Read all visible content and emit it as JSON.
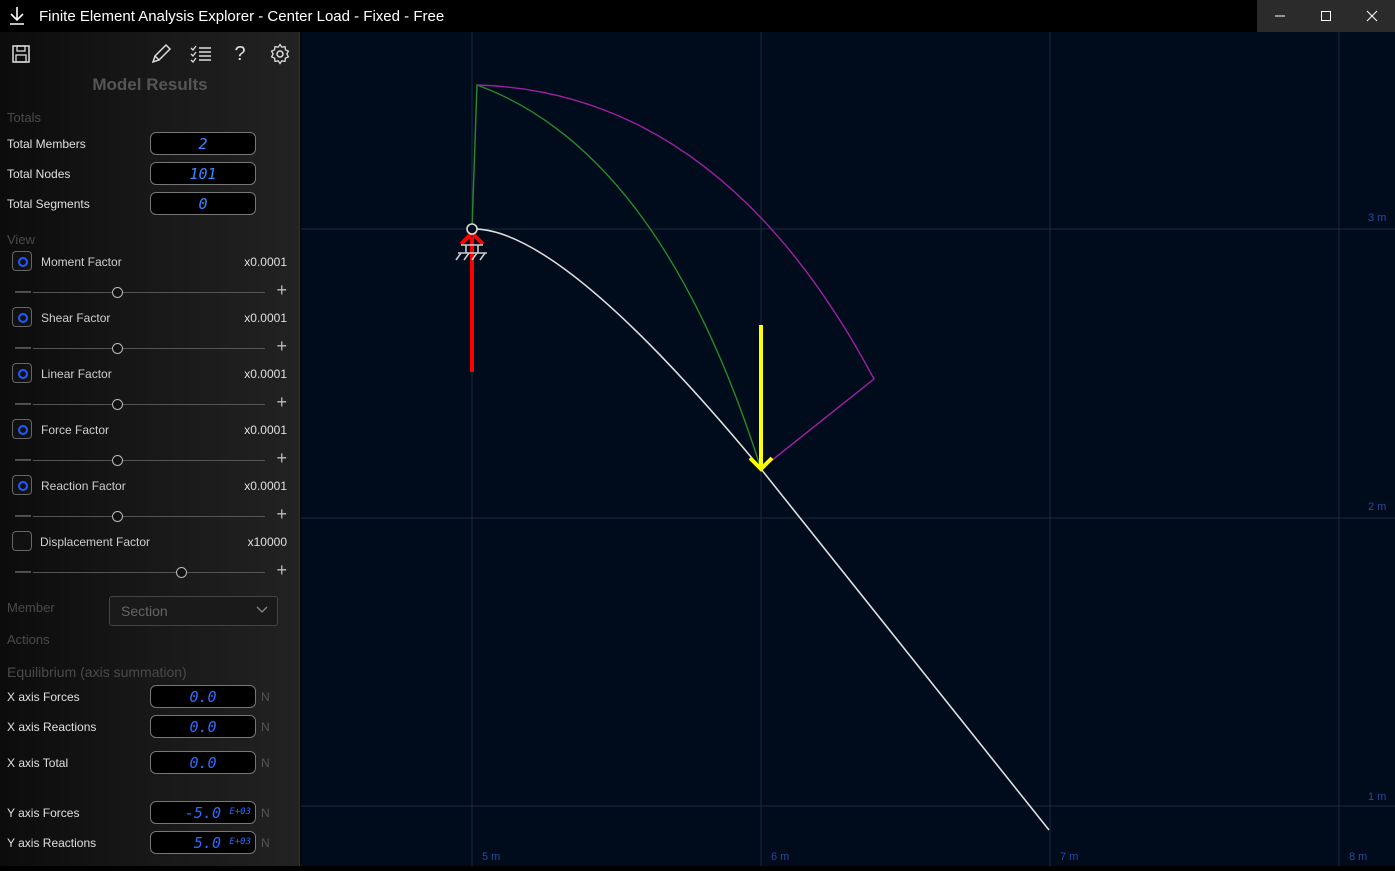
{
  "window": {
    "title": "Finite Element Analysis Explorer - Center Load - Fixed - Free",
    "minimize": "—",
    "maximize": "☐",
    "close": "✕"
  },
  "sidebar": {
    "heading": "Model Results",
    "totals_label": "Totals",
    "totals": [
      {
        "label": "Total Members",
        "value": "2"
      },
      {
        "label": "Total Nodes",
        "value": "101"
      },
      {
        "label": "Total Segments",
        "value": "0"
      }
    ],
    "view_label": "View",
    "factors": [
      {
        "label": "Moment Factor",
        "value": "x0.0001",
        "checked": true,
        "slider_pos": 0.36
      },
      {
        "label": "Shear Factor",
        "value": "x0.0001",
        "checked": true,
        "slider_pos": 0.36
      },
      {
        "label": "Linear Factor",
        "value": "x0.0001",
        "checked": true,
        "slider_pos": 0.36
      },
      {
        "label": "Force Factor",
        "value": "x0.0001",
        "checked": true,
        "slider_pos": 0.36
      },
      {
        "label": "Reaction Factor",
        "value": "x0.0001",
        "checked": true,
        "slider_pos": 0.36
      },
      {
        "label": "Displacement Factor",
        "value": "x10000",
        "checked": false,
        "slider_pos": 0.64
      }
    ],
    "minus_glyph": "—",
    "plus_glyph": "+",
    "member_label": "Member",
    "section_placeholder": "Section",
    "actions_label": "Actions",
    "equilibrium_label": "Equilibrium (axis summation)",
    "equilibrium": [
      {
        "label": "X axis Forces",
        "value": "0.0",
        "exp": "",
        "unit": "N"
      },
      {
        "label": "X axis Reactions",
        "value": "0.0",
        "exp": "",
        "unit": "N"
      },
      {
        "label": "X axis Total",
        "value": "0.0",
        "exp": "",
        "unit": "N"
      },
      {
        "label": "Y axis Forces",
        "value": "-5.0",
        "exp": "E+03",
        "unit": "N"
      },
      {
        "label": "Y axis Reactions",
        "value": "5.0",
        "exp": "E+03",
        "unit": "N"
      }
    ]
  },
  "icons": {
    "save": "save-icon",
    "edit": "pencil-icon",
    "checklist": "checklist-icon",
    "help": "help-icon",
    "settings": "gear-icon",
    "help_glyph": "?"
  },
  "canvas": {
    "x_ticks": [
      "5 m",
      "6 m",
      "7 m",
      "8 m"
    ],
    "y_ticks": [
      "3 m",
      "2 m",
      "1 m"
    ],
    "colors": {
      "background": "#000b1c",
      "grid": "#1c2b3d",
      "structure": "#e0e0e0",
      "moment": "#a020a0",
      "shear": "#2a8a2a",
      "load": "#ffff00",
      "reaction": "#ff0000",
      "axis_text": "#2a4aa0"
    }
  }
}
